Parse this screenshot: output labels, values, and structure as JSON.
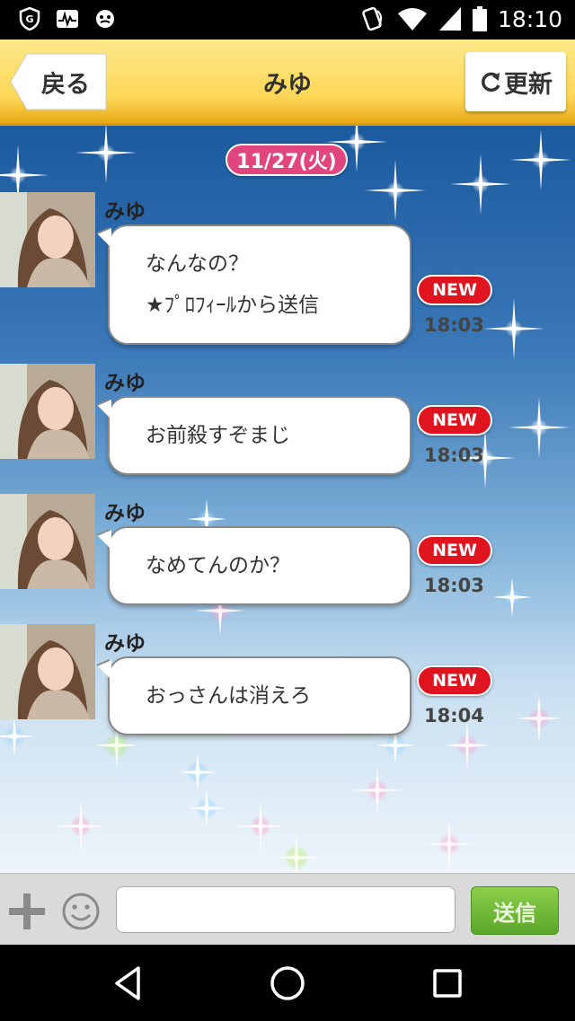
{
  "status_bar": {
    "time": "18:10",
    "left_icons": [
      "shield-g-icon",
      "activity-icon",
      "app-face-icon"
    ],
    "right_icons": [
      "nfc-icon",
      "wifi-icon",
      "signal-icon",
      "battery-icon"
    ]
  },
  "header": {
    "back_label": "戻る",
    "title": "みゆ",
    "refresh_label": "更新",
    "color": "#fbd655"
  },
  "chat": {
    "date": "11/27(火)",
    "messages": [
      {
        "sender": "みゆ",
        "lines": [
          "なんなの？",
          "★ﾌﾟﾛﾌｨｰﾙから送信"
        ],
        "badge": "NEW",
        "time": "18:03"
      },
      {
        "sender": "みゆ",
        "lines": [
          "お前殺すぞまじ"
        ],
        "badge": "NEW",
        "time": "18:03"
      },
      {
        "sender": "みゆ",
        "lines": [
          "なめてんのか？"
        ],
        "badge": "NEW",
        "time": "18:03"
      },
      {
        "sender": "みゆ",
        "lines": [
          "おっさんは消えろ"
        ],
        "badge": "NEW",
        "time": "18:04"
      }
    ]
  },
  "input_bar": {
    "placeholder": "",
    "send_label": "送信",
    "send_color": "#6bb836"
  },
  "nav_bar": {
    "icons": [
      "back-triangle-icon",
      "home-circle-icon",
      "recents-square-icon"
    ]
  }
}
